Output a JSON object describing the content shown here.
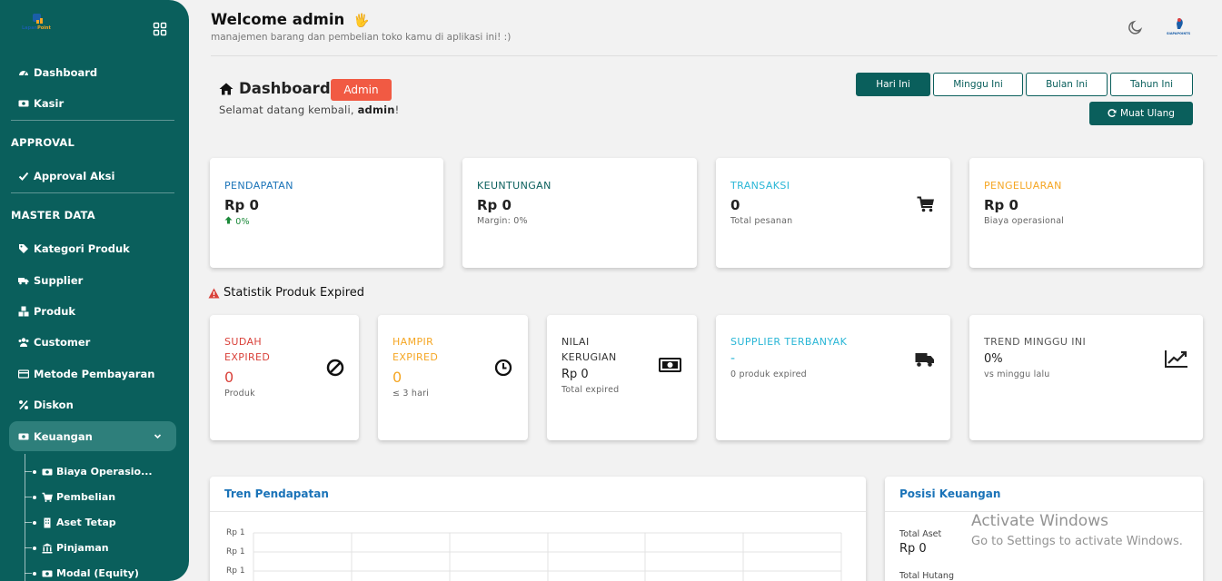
{
  "sidebar": {
    "logo_text_1": "Lapan",
    "logo_text_2": "Point",
    "items_top": [
      {
        "label": "Dashboard",
        "icon": "dashboard-icon"
      },
      {
        "label": "Kasir",
        "icon": "money-icon"
      }
    ],
    "section_approval": "APPROVAL",
    "approval_items": [
      {
        "label": "Approval Aksi",
        "icon": "check-icon"
      }
    ],
    "section_master": "MASTER DATA",
    "master_items": [
      {
        "label": "Kategori Produk",
        "icon": "tag-icon"
      },
      {
        "label": "Supplier",
        "icon": "truck-icon"
      },
      {
        "label": "Produk",
        "icon": "cubes-icon"
      },
      {
        "label": "Customer",
        "icon": "users-icon"
      },
      {
        "label": "Metode Pembayaran",
        "icon": "credit-card-icon"
      },
      {
        "label": "Diskon",
        "icon": "percent-icon"
      },
      {
        "label": "Keuangan",
        "icon": "money-icon"
      }
    ],
    "keuangan_sub": [
      {
        "label": "Biaya Operasio...",
        "icon": "money-icon"
      },
      {
        "label": "Pembelian",
        "icon": "cart-icon"
      },
      {
        "label": "Aset Tetap",
        "icon": "building-icon"
      },
      {
        "label": "Pinjaman",
        "icon": "bank-icon"
      },
      {
        "label": "Modal (Equity)",
        "icon": "money-icon"
      }
    ]
  },
  "topbar": {
    "title": "Welcome admin",
    "emoji": "🖐",
    "subtitle": "manajemen barang dan pembelian toko kamu di aplikasi ini! :)",
    "avatar_text": "SIAPAPOINTS"
  },
  "header": {
    "title": "Dashboard",
    "badge": "Admin",
    "welcome_prefix": "Selamat datang kembali, ",
    "welcome_user": "admin",
    "welcome_suffix": "!"
  },
  "period": {
    "buttons": [
      "Hari Ini",
      "Minggu Ini",
      "Bulan Ini",
      "Tahun Ini"
    ],
    "active": "Hari Ini",
    "reload": "Muat Ulang"
  },
  "stats": [
    {
      "label": "PENDAPATAN",
      "value": "Rp 0",
      "note": "0%",
      "color": "#1a73b8"
    },
    {
      "label": "KEUNTUNGAN",
      "value": "Rp 0",
      "note": "Margin: 0%",
      "color": "#0a5f5c"
    },
    {
      "label": "TRANSAKSI",
      "value": "0",
      "note": "Total pesanan",
      "color": "#29b6d6"
    },
    {
      "label": "PENGELUARAN",
      "value": "Rp 0",
      "note": "Biaya operasional",
      "color": "#f5a623"
    }
  ],
  "expired_title": "Statistik Produk Expired",
  "expired": [
    {
      "label_1": "SUDAH",
      "label_2": "EXPIRED",
      "value": "0",
      "note": "Produk",
      "color": "#d9413a"
    },
    {
      "label_1": "HAMPIR",
      "label_2": "EXPIRED",
      "value": "0",
      "note": "≤ 3 hari",
      "color": "#f5a623"
    },
    {
      "label_1": "NILAI",
      "label_2": "KERUGIAN",
      "value": "Rp 0",
      "note": "Total expired",
      "color": "#333333"
    },
    {
      "label": "SUPPLIER TERBANYAK",
      "value": "-",
      "note": "0 produk expired",
      "color": "#29b6d6"
    },
    {
      "label": "TREND MINGGU INI",
      "value": "0%",
      "note": "vs minggu lalu",
      "color": "#555555"
    }
  ],
  "tren": {
    "title": "Tren Pendapatan",
    "y_ticks": [
      "Rp 1",
      "Rp 1",
      "Rp 1"
    ]
  },
  "posisi": {
    "title": "Posisi Keuangan",
    "aset_label": "Total Aset",
    "aset_value": "Rp 0",
    "hutang_label": "Total Hutang"
  },
  "watermark": {
    "line1": "Activate Windows",
    "line2": "Go to Settings to activate Windows."
  }
}
